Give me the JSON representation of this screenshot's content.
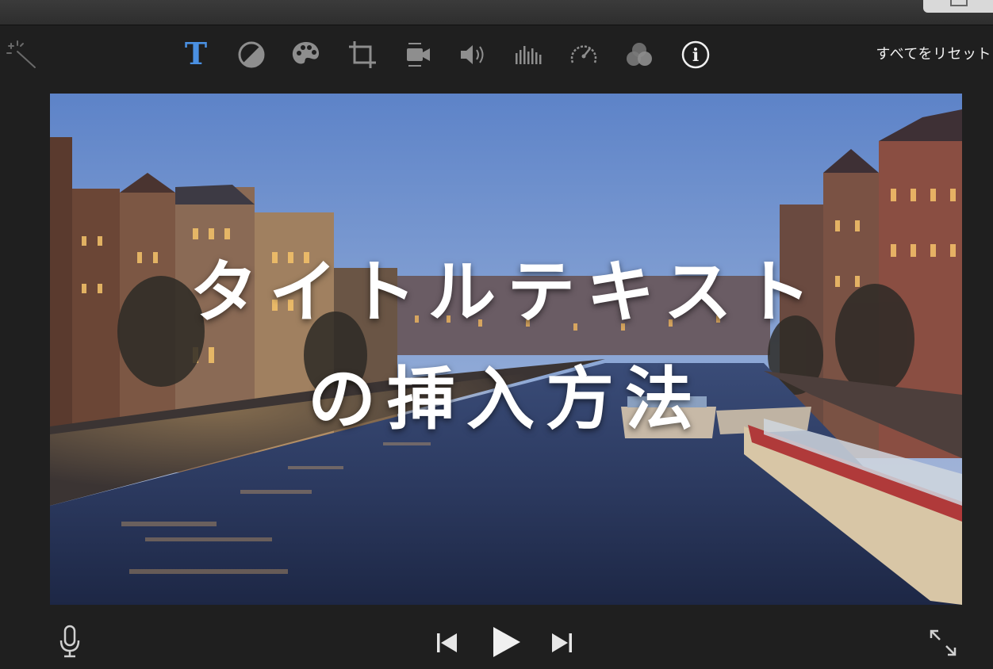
{
  "toolbar": {
    "tools": [
      {
        "name": "magic-wand-icon",
        "active": false
      },
      {
        "name": "title-text-icon",
        "active": true
      },
      {
        "name": "color-balance-icon",
        "active": false
      },
      {
        "name": "color-correction-palette-icon",
        "active": false
      },
      {
        "name": "crop-icon",
        "active": false
      },
      {
        "name": "stabilization-camera-icon",
        "active": false
      },
      {
        "name": "volume-icon",
        "active": false
      },
      {
        "name": "equalizer-icon",
        "active": false
      },
      {
        "name": "speed-gauge-icon",
        "active": false
      },
      {
        "name": "clip-filter-icon",
        "active": false
      },
      {
        "name": "info-icon",
        "active": false
      }
    ],
    "reset_label": "すべてをリセット",
    "active_color": "#4a90e2",
    "icon_color": "#8e8e8e"
  },
  "viewer": {
    "title_line1": "タイトルテキスト",
    "title_line2": "の挿入方法"
  },
  "playback": {
    "voiceover": "microphone-icon",
    "previous": "skip-back-icon",
    "play": "play-icon",
    "next": "skip-forward-icon",
    "fullscreen": "fullscreen-expand-icon"
  }
}
